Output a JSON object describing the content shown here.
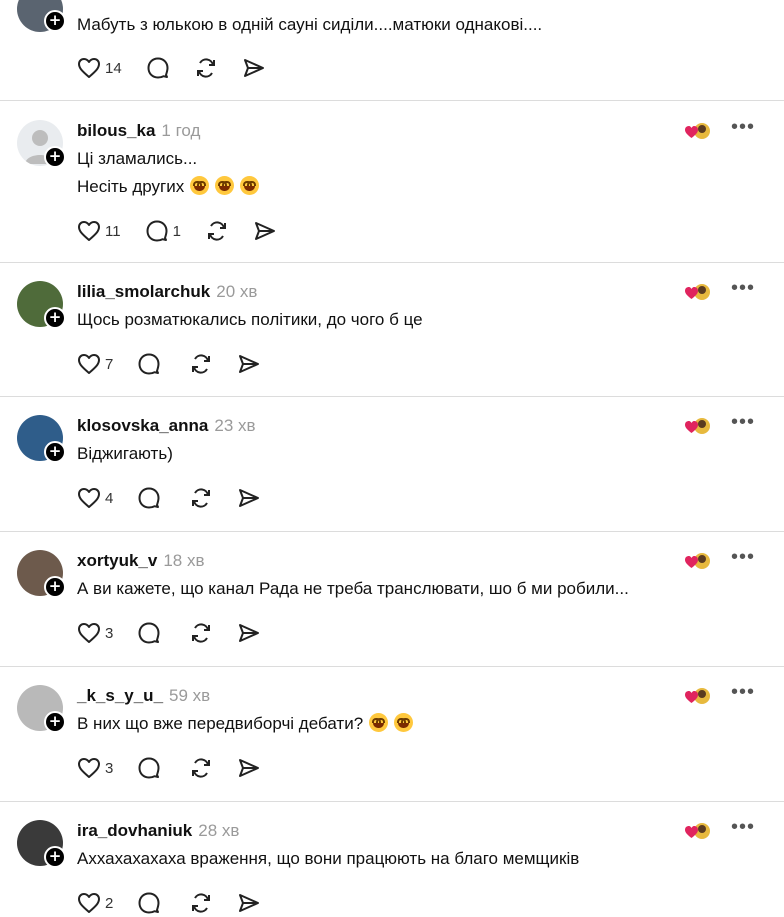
{
  "icons": {
    "like": "heart-icon",
    "comment": "comment-bubble-icon",
    "repost": "repost-icon",
    "share": "send-icon",
    "more": "more-options-icon",
    "follow": "plus-icon"
  },
  "colors": {
    "accent": "#e0245e",
    "divider": "#dcdcdc",
    "muted": "#9a9a9a"
  },
  "top_comment": {
    "text": "Мабуть з юлькою в одній сауні сиділи....матюки однакові....",
    "likes": "14"
  },
  "comments": [
    {
      "username": "bilous_ka",
      "time": "1 год",
      "lines": [
        "Ці зламались...",
        "Несіть других"
      ],
      "emoji_count": 3,
      "likes": "11",
      "replies": "1"
    },
    {
      "username": "lilia_smolarchuk",
      "time": "20 хв",
      "lines": [
        "Щось розматюкались політики, до чого б це"
      ],
      "likes": "7",
      "replies": ""
    },
    {
      "username": "klosovska_anna",
      "time": "23 хв",
      "lines": [
        "Віджигають)"
      ],
      "likes": "4",
      "replies": ""
    },
    {
      "username": "xortyuk_v",
      "time": "18 хв",
      "lines": [
        "А ви кажете, що канал Рада не треба транслювати, шо б ми робили..."
      ],
      "likes": "3",
      "replies": ""
    },
    {
      "username": "_k_s_y_u_",
      "time": "59 хв",
      "lines": [
        "В них що вже передвиборчі дебати?"
      ],
      "emoji_count": 2,
      "likes": "3",
      "replies": ""
    },
    {
      "username": "ira_dovhaniuk",
      "time": "28 хв",
      "lines": [
        "Аххахахахаха враження, що вони працюють на благо мемщиків"
      ],
      "likes": "2",
      "replies": ""
    }
  ]
}
